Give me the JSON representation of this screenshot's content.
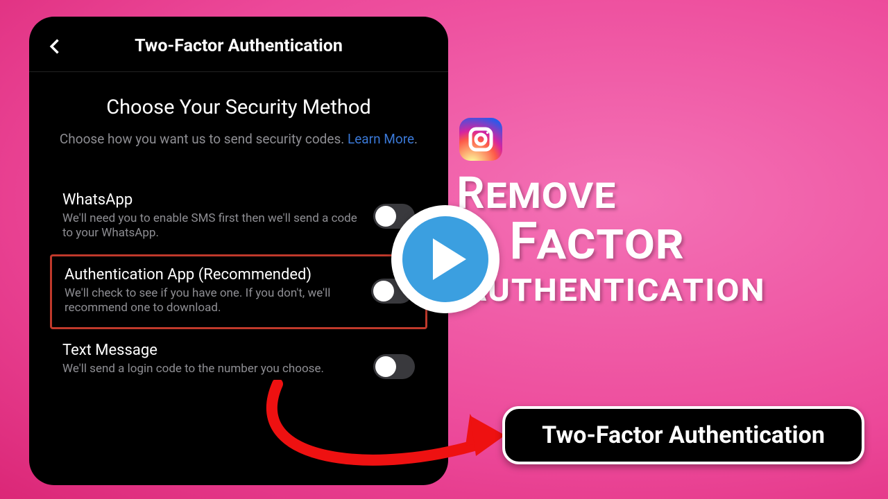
{
  "phone": {
    "header_title": "Two-Factor Authentication",
    "section_heading": "Choose Your Security Method",
    "section_sub_prefix": "Choose how you want us to send security codes. ",
    "learn_more": "Learn More",
    "period": ".",
    "options": [
      {
        "title": "WhatsApp",
        "desc": "We'll need you to enable SMS first then we'll send a code to your WhatsApp."
      },
      {
        "title": "Authentication App (Recommended)",
        "desc": "We'll check to see if you have one. If you don't, we'll recommend one to download."
      },
      {
        "title": "Text Message",
        "desc": "We'll send a login code to the number you choose."
      }
    ]
  },
  "headline": {
    "w1": "Remove",
    "w2": "Factor",
    "w3": "Authentication"
  },
  "badge_label": "Two-Factor Authentication"
}
